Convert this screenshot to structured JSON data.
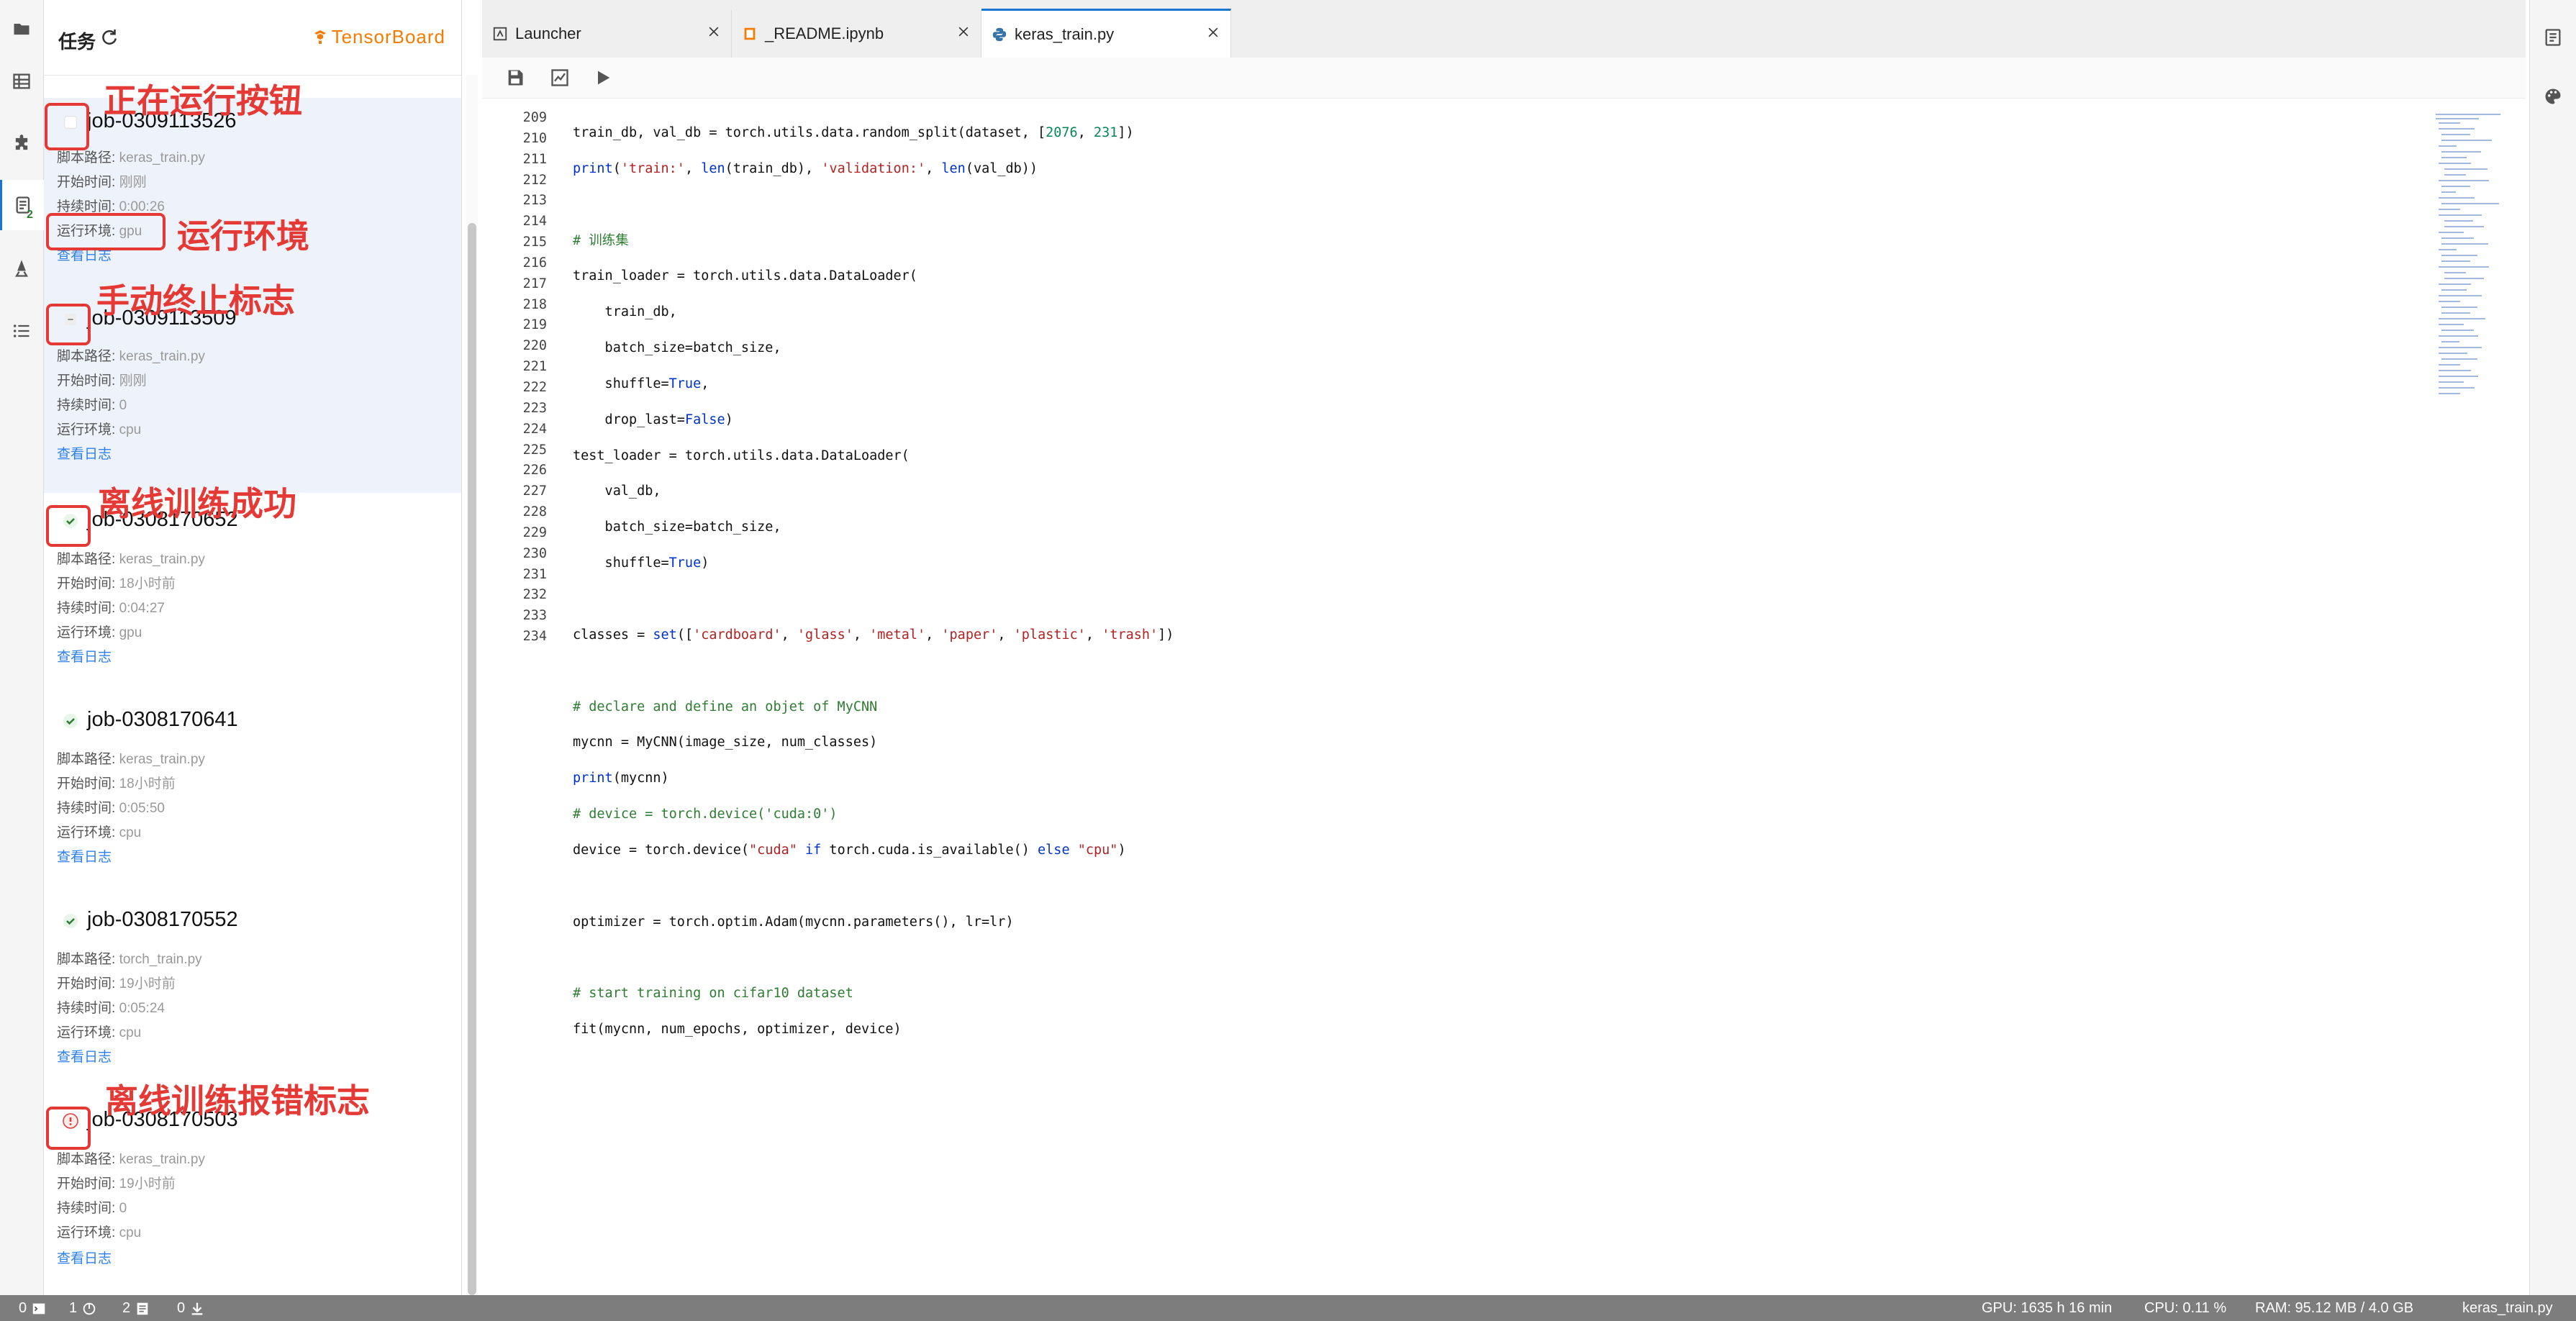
{
  "task_panel": {
    "title": "任务",
    "tensorboard_label": "TensorBoard",
    "jobs": [
      {
        "name": "job-0309113526",
        "script_label": "脚本路径: ",
        "script": "keras_train.py",
        "start_label": "开始时间: ",
        "start": "刚刚",
        "duration_label": "持续时间: ",
        "duration": "0:00:26",
        "env_label": "运行环境: ",
        "env": "gpu",
        "log": "查看日志",
        "status": "running"
      },
      {
        "name": "job-0309113509",
        "script_label": "脚本路径: ",
        "script": "keras_train.py",
        "start_label": "开始时间: ",
        "start": "刚刚",
        "duration_label": "持续时间: ",
        "duration": "0",
        "env_label": "运行环境: ",
        "env": "cpu",
        "log": "查看日志",
        "status": "stopped"
      },
      {
        "name": "job-0308170652",
        "script_label": "脚本路径: ",
        "script": "keras_train.py",
        "start_label": "开始时间: ",
        "start": "18小时前",
        "duration_label": "持续时间: ",
        "duration": "0:04:27",
        "env_label": "运行环境: ",
        "env": "gpu",
        "log": "查看日志",
        "status": "success"
      },
      {
        "name": "job-0308170641",
        "script_label": "脚本路径: ",
        "script": "keras_train.py",
        "start_label": "开始时间: ",
        "start": "18小时前",
        "duration_label": "持续时间: ",
        "duration": "0:05:50",
        "env_label": "运行环境: ",
        "env": "cpu",
        "log": "查看日志",
        "status": "success"
      },
      {
        "name": "job-0308170552",
        "script_label": "脚本路径: ",
        "script": "torch_train.py",
        "start_label": "开始时间: ",
        "start": "19小时前",
        "duration_label": "持续时间: ",
        "duration": "0:05:24",
        "env_label": "运行环境: ",
        "env": "cpu",
        "log": "查看日志",
        "status": "success"
      },
      {
        "name": "job-0308170503",
        "script_label": "脚本路径: ",
        "script": "keras_train.py",
        "start_label": "开始时间: ",
        "start": "19小时前",
        "duration_label": "持续时间: ",
        "duration": "0",
        "env_label": "运行环境: ",
        "env": "cpu",
        "log": "查看日志",
        "status": "error"
      }
    ]
  },
  "annotations": {
    "running_button": "正在运行按钮",
    "run_env": "运行环境",
    "manual_stop": "手动终止标志",
    "offline_success": "离线训练成功",
    "offline_error": "离线训练报错标志"
  },
  "tabs": [
    {
      "label": "Launcher",
      "icon": "launcher-icon"
    },
    {
      "label": "_README.ipynb",
      "icon": "notebook-icon"
    },
    {
      "label": "keras_train.py",
      "icon": "python-icon"
    }
  ],
  "editor": {
    "line_numbers": [
      "209",
      "210",
      "211",
      "212",
      "213",
      "214",
      "215",
      "216",
      "217",
      "218",
      "219",
      "220",
      "221",
      "222",
      "223",
      "224",
      "225",
      "226",
      "227",
      "228",
      "229",
      "230",
      "231",
      "232",
      "233",
      "234"
    ]
  },
  "status_bar": {
    "terminals": "0",
    "kernels": "1",
    "git_changes": "2",
    "downloads": "0",
    "gpu": "GPU: 1635 h 16 min",
    "cpu": "CPU: 0.11 %",
    "ram": "RAM: 95.12 MB / 4.0 GB",
    "file": "keras_train.py"
  },
  "colors": {
    "accent": "#1976d2",
    "annotation": "#e53935",
    "tensorboard": "#f57c00",
    "success": "#2e7d32",
    "error": "#e53935",
    "link": "#2f80ed"
  }
}
